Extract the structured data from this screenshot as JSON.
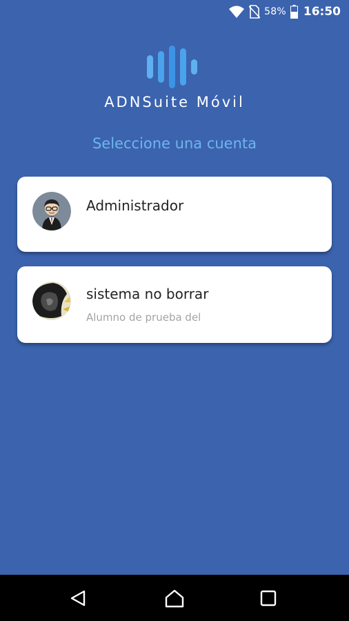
{
  "status_bar": {
    "battery_percent": "58%",
    "time": "16:50"
  },
  "app": {
    "brand": "ADNSuite Móvil",
    "prompt": "Seleccione una cuenta",
    "logo_colors": [
      "#5fb0f0",
      "#4aa3ec",
      "#3d93e4",
      "#4aa3ec",
      "#5fb0f0"
    ]
  },
  "accounts": [
    {
      "name": "Administrador",
      "subtitle": "",
      "avatar_icon": "businessman-avatar-icon"
    },
    {
      "name": "sistema no borrar",
      "subtitle": "Alumno de prueba del",
      "avatar_icon": "profile-photo-avatar"
    }
  ],
  "navigation": {
    "back_icon": "back-triangle-icon",
    "home_icon": "home-icon",
    "recents_icon": "recents-square-icon"
  },
  "colors": {
    "background": "#3b63ae",
    "prompt": "#6fb5ee",
    "card": "#ffffff",
    "subtitle": "#a3a3a3"
  }
}
